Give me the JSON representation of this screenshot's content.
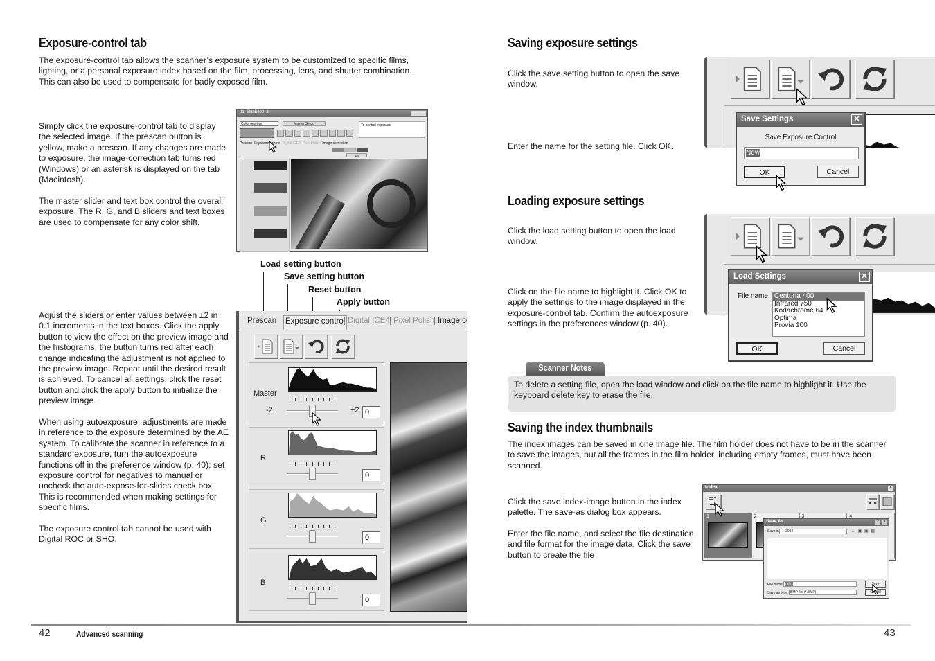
{
  "left_page": {
    "title": "Exposure-control tab",
    "intro": "The exposure-control tab allows the scanner’s exposure system to be customized to specific films, lighting, or a personal exposure index based on the film, processing, lens, and shutter combination. This can also be used to compensate for badly exposed film.",
    "para1": "Simply click the exposure-control tab to display the selected image. If the prescan button is yellow, make a prescan. If any changes are made to exposure, the image-correction tab turns red (Windows) or an asterisk is displayed on the tab (Macintosh).",
    "para2": "The master slider and text box control the overall exposure. The R, G, and B sliders and text boxes are used to compensate for any color shift.",
    "para3": "Adjust the sliders or enter values between ±2 in 0.1 increments in the text boxes. Click the apply button to view the effect on the preview image and the histograms; the button turns red after each change indicating the adjustment is not applied to the preview image. Repeat until the desired result is achieved. To cancel all settings, click the reset button and click the apply button to initialize the preview image.",
    "para4": "When using autoexposure, adjustments are made in reference to the exposure determined by the AE system. To calibrate the scanner in reference to a standard exposure, turn the autoexposure functions off in the preference window (p. 40); set exposure control for negatives to manual or uncheck the auto-expose-for-slides check box. This is recommended when making settings for specific films.",
    "para5": "The exposure control tab cannot be used with Digital ROC or SHO.",
    "small_window": {
      "title": "01_Elite5400_3",
      "film_type": "Color positive",
      "master_setup": "Master Setup",
      "hint": "To control exposure",
      "tabs": [
        "Prescan",
        "Exposure control",
        "Digital ICE4",
        "Pixel Polish",
        "Image correction"
      ],
      "zoom_readout": "1/4"
    },
    "callouts": {
      "load": "Load setting button",
      "save": "Save setting button",
      "reset": "Reset button",
      "apply": "Apply button"
    },
    "large_panel": {
      "tabs": [
        "Prescan",
        "Exposure control",
        "Digital ICE4",
        "Pixel Polish",
        "Image cor"
      ],
      "channels": [
        {
          "label": "Master",
          "min": "-2",
          "max": "+2",
          "value": "0",
          "slider_position": 0.5
        },
        {
          "label": "R",
          "value": "0",
          "slider_position": 0.5
        },
        {
          "label": "G",
          "value": "0",
          "slider_position": 0.5
        },
        {
          "label": "B",
          "value": "0",
          "slider_position": 0.5
        }
      ]
    },
    "page_number": "42",
    "section_name": "Advanced scanning"
  },
  "right_page": {
    "save_title": "Saving exposure settings",
    "save_step1": "Click the save setting button to open the save window.",
    "save_step2": "Enter the name for the setting file. Click OK.",
    "save_dialog": {
      "title": "Save Settings",
      "caption": "Save Exposure Control",
      "name_value": "New",
      "ok": "OK",
      "cancel": "Cancel"
    },
    "load_title": "Loading exposure settings",
    "load_step1": "Click the load setting button to open the load window.",
    "load_step2": "Click on the file name to highlight it. Click OK to apply the settings to the image displayed in the exposure-control tab. Confirm the autoexposure settings in the preferences window (p. 40).",
    "load_dialog": {
      "title": "Load Settings",
      "file_label": "File name",
      "files": [
        "Centuria 400",
        "Infrared 750",
        "Kodachrome 64",
        "Optima",
        "Provia 100"
      ],
      "selected_index": 0,
      "ok": "OK",
      "cancel": "Cancel"
    },
    "notes_tab": "Scanner Notes",
    "notes_text": "To delete a setting file, open the load window and click on the file name to highlight it. Use the keyboard delete key to erase the file.",
    "index_title": "Saving the index thumbnails",
    "index_intro": "The index images can be saved in one image file. The film holder does not have to be in the scanner to save the images, but all the frames in the film holder, including empty frames, must have been scanned.",
    "index_step1": "Click the save index-image button in the index palette. The save-as dialog box appears.",
    "index_step2": "Enter the file name, and select the file destination and file format for the image data. Click the save button to create the file",
    "index_window": {
      "title": "Index",
      "frames": [
        "1",
        "2",
        "3",
        "4"
      ]
    },
    "saveas_dialog": {
      "title": "Save As",
      "save_in_label": "Save in:",
      "save_in_value": "2002",
      "file_name_label": "File name:",
      "file_name_value": "index",
      "type_label": "Save as type:",
      "type_value": "BMP file (*.BMP)",
      "save": "Save",
      "cancel": "Cancel"
    },
    "page_number": "43"
  }
}
